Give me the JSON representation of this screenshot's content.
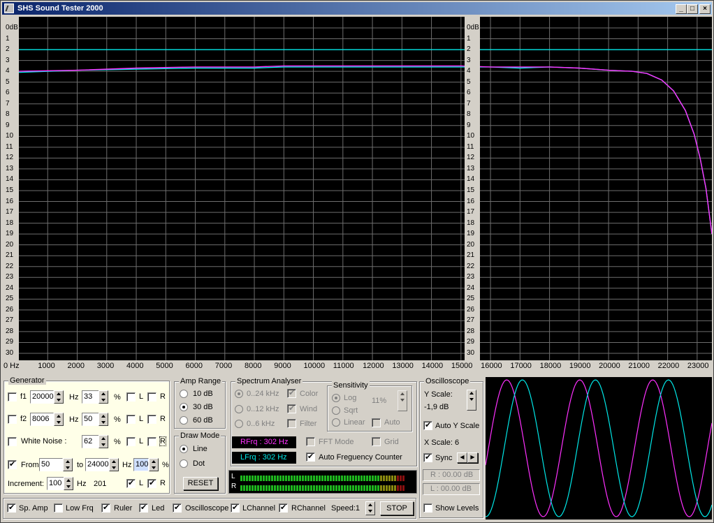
{
  "title": "SHS Sound Tester 2000",
  "xaxis": {
    "labels": [
      "0 Hz",
      "1000",
      "2000",
      "3000",
      "4000",
      "5000",
      "6000",
      "7000",
      "8000",
      "9000",
      "10000",
      "11000",
      "12000",
      "13000",
      "14000",
      "15000",
      "16000",
      "17000",
      "18000",
      "19000",
      "20000",
      "21000",
      "22000",
      "23000"
    ]
  },
  "yaxis": {
    "labels": [
      "0dB",
      "1",
      "2",
      "3",
      "4",
      "5",
      "6",
      "7",
      "8",
      "9",
      "10",
      "11",
      "12",
      "13",
      "14",
      "15",
      "16",
      "17",
      "18",
      "19",
      "20",
      "21",
      "22",
      "23",
      "24",
      "25",
      "26",
      "27",
      "28",
      "29",
      "30"
    ]
  },
  "chart_data": {
    "type": "line",
    "xlim": [
      0,
      23500
    ],
    "ylim": [
      0,
      31
    ],
    "grid": true,
    "series": [
      {
        "color": "#00e8e8",
        "x": [
          0,
          23500
        ],
        "y": [
          2,
          2
        ]
      },
      {
        "color": "#00e8e8",
        "x": [
          0,
          2000,
          4000,
          6000,
          8000,
          9000,
          10000,
          11000,
          12000,
          13000,
          14000,
          15000,
          16000,
          17000,
          18000,
          19000,
          20000,
          20800,
          21300,
          21800,
          22200,
          22600,
          22900,
          23100,
          23300,
          23500
        ],
        "y": [
          4.1,
          3.9,
          3.8,
          3.7,
          3.7,
          3.6,
          3.6,
          3.6,
          3.6,
          3.6,
          3.6,
          3.6,
          3.6,
          3.7,
          3.6,
          3.7,
          3.9,
          4.0,
          4.2,
          4.8,
          5.8,
          7.6,
          9.8,
          12.0,
          14.8,
          19.0
        ]
      },
      {
        "color": "#ff30ff",
        "x": [
          0,
          2000,
          4000,
          6000,
          8000,
          9000,
          10000,
          11000,
          12000,
          13000,
          14000,
          15000,
          16000,
          17000,
          18000,
          19000,
          20000,
          20800,
          21300,
          21800,
          22200,
          22600,
          22900,
          23100,
          23300,
          23500
        ],
        "y": [
          4.0,
          3.9,
          3.7,
          3.6,
          3.6,
          3.5,
          3.5,
          3.5,
          3.5,
          3.5,
          3.5,
          3.5,
          3.6,
          3.6,
          3.6,
          3.7,
          3.9,
          4.0,
          4.2,
          4.8,
          5.8,
          7.6,
          9.8,
          12.0,
          14.8,
          19.0
        ]
      }
    ]
  },
  "generator": {
    "title": "Generator",
    "f1": {
      "label": "f1",
      "value": "20000",
      "unit": "Hz",
      "pct": "33",
      "pct_unit": "%"
    },
    "f2": {
      "label": "f2",
      "value": "8006",
      "unit": "Hz",
      "pct": "50",
      "pct_unit": "%"
    },
    "noise": {
      "label": "White Noise :",
      "pct": "62",
      "pct_unit": "%"
    },
    "sweep": {
      "label": "From",
      "from": "50",
      "to_label": "to",
      "to": "24000",
      "unit": "Hz",
      "pct": "100",
      "pct_unit": "%"
    },
    "increment": {
      "label": "Increment:",
      "value": "100",
      "unit": "Hz",
      "count": "201"
    },
    "l": "L",
    "r": "R"
  },
  "amp": {
    "title": "Amp Range",
    "opts": [
      "10 dB",
      "30 dB",
      "60 dB"
    ]
  },
  "draw": {
    "title": "Draw Mode",
    "opts": [
      "Line",
      "Dot"
    ],
    "reset": "RESET"
  },
  "spectrum": {
    "title": "Spectrum Analyser",
    "ranges": [
      "0..24 kHz",
      "0..12 kHz",
      "0..6 kHz"
    ],
    "color": "Color",
    "wind": "Wind",
    "filter": "Filter",
    "fft": "FFT Mode",
    "grid": "Grid",
    "rfrq": "RFrq : 302 Hz",
    "lfrq": "LFrq : 302 Hz",
    "auto_counter": "Auto Freguency Counter"
  },
  "sensitivity": {
    "title": "Sensitivity",
    "opts": [
      "Log",
      "Sqrt",
      "Linear"
    ],
    "pct": "11%",
    "auto": "Auto"
  },
  "scope": {
    "title": "Oscilloscope",
    "yscale_label": "Y Scale:",
    "yscale_value": "-1,9 dB",
    "auto_y": "Auto Y Scale",
    "xscale": "X Scale: 6",
    "sync": "Sync",
    "r_db": "R : 00.00 dB",
    "l_db": "L : 00.00 dB",
    "show_levels": "Show Levels"
  },
  "meter": {
    "l": "L",
    "r": "R",
    "level": 0.94
  },
  "bottom": {
    "items": [
      "Sp. Amp",
      "Low Frq",
      "Ruler",
      "Led",
      "Oscilloscope",
      "LChannel",
      "RChannel"
    ],
    "speed": "Speed:1",
    "stop": "STOP"
  },
  "colors": {
    "cyan": "#00e8e8",
    "magenta": "#ff30ff",
    "grid": "#6e6e6e"
  }
}
